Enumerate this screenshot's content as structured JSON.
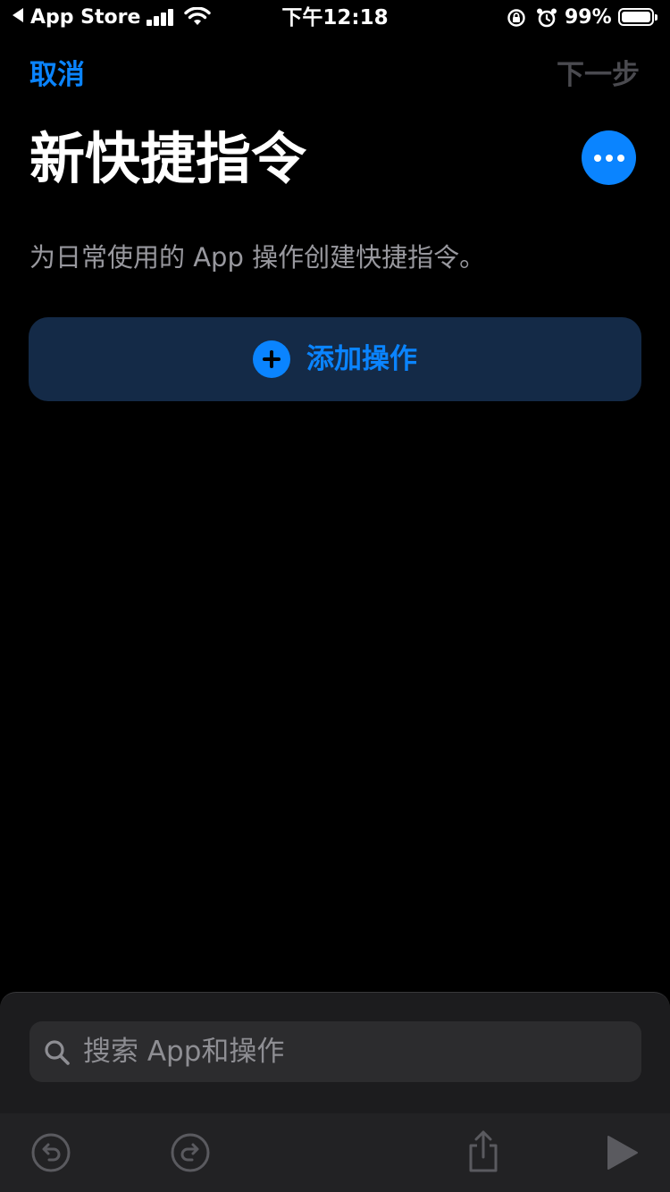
{
  "status_bar": {
    "back_app": "App Store",
    "time": "下午12:18",
    "battery_percent": "99%"
  },
  "nav": {
    "cancel_label": "取消",
    "next_label": "下一步"
  },
  "title": "新快捷指令",
  "subtitle": "为日常使用的 App 操作创建快捷指令。",
  "add_action_label": "添加操作",
  "search": {
    "placeholder": "搜索 App和操作"
  },
  "colors": {
    "accent": "#0a84ff",
    "background": "#000000",
    "card": "#142a47",
    "sheet": "#1c1c1e",
    "disabled": "#4a4a4f"
  },
  "icons": {
    "more": "ellipsis-icon",
    "add": "plus-circle-icon",
    "search": "magnifier-icon",
    "undo": "undo-icon",
    "redo": "redo-icon",
    "share": "share-icon",
    "play": "play-icon"
  }
}
